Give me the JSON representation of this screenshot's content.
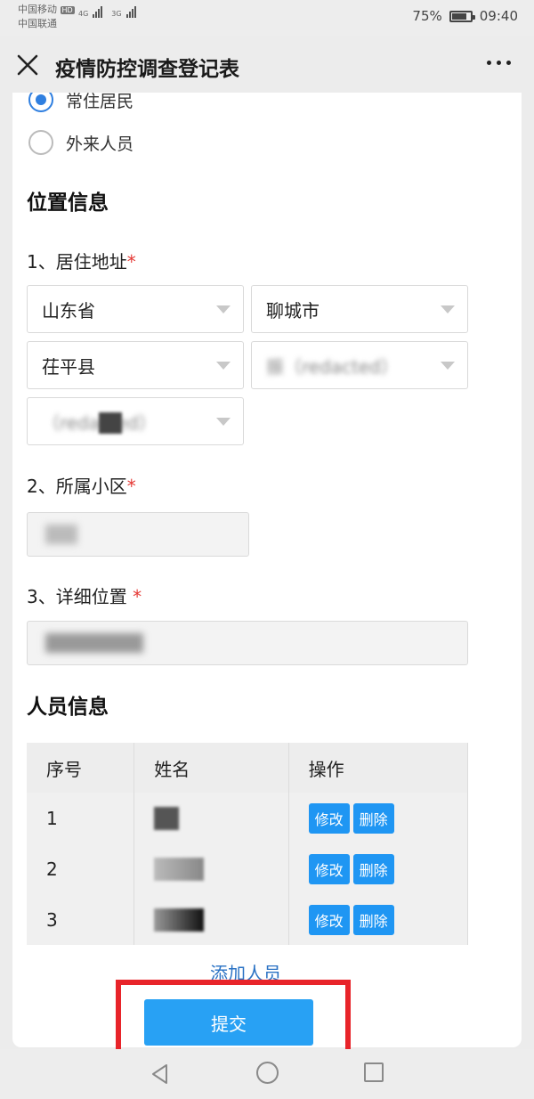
{
  "status": {
    "carrier1": "中国移动",
    "carrier1_tag": "HD",
    "carrier2": "中国联通",
    "net1": "4G",
    "net2": "3G",
    "battery": "75%",
    "time": "09:40"
  },
  "titlebar": {
    "title": "疫情防控调查登记表",
    "close_icon": "close-icon",
    "more_icon": "more-icon"
  },
  "resident_type": {
    "options": [
      "常住居民",
      "外来人员"
    ],
    "selected": "常住居民"
  },
  "location": {
    "section_title": "位置信息",
    "address_label": "1、居住地址",
    "province": "山东省",
    "city": "聊城市",
    "county": "茌平县",
    "street": "振（redacted）",
    "village": "（redacted）",
    "community_label": "2、所属小区",
    "community_value": "",
    "detail_label": "3、详细位置 ",
    "detail_value": "",
    "required_mark": "*"
  },
  "people": {
    "section_title": "人员信息",
    "columns": [
      "序号",
      "姓名",
      "操作"
    ],
    "rows": [
      {
        "index": "1",
        "name": ""
      },
      {
        "index": "2",
        "name": ""
      },
      {
        "index": "3",
        "name": ""
      }
    ],
    "edit_label": "修改",
    "delete_label": "删除",
    "add_label": "添加人员"
  },
  "submit_label": "提交",
  "colors": {
    "primary": "#28a1f4",
    "link": "#2a72c4",
    "required": "#e53935",
    "highlight": "#e8242a"
  }
}
